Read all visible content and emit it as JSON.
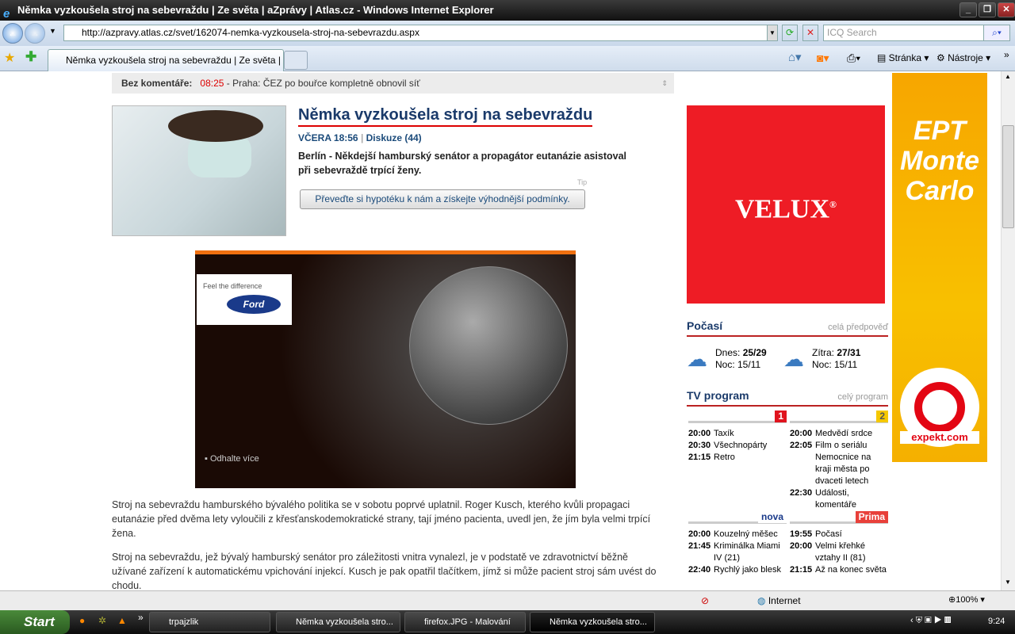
{
  "window": {
    "title": "Němka vyzkoušela stroj na sebevraždu | Ze světa | aZprávy | Atlas.cz - Windows Internet Explorer"
  },
  "browser": {
    "url": "http://azpravy.atlas.cz/svet/162074-nemka-vyzkousela-stroj-na-sebevrazdu.aspx",
    "search_placeholder": "ICQ Search",
    "tab_label": "Němka vyzkoušela stroj na sebevraždu | Ze světa | a...",
    "page_menu": "Stránka",
    "tools_menu": "Nástroje"
  },
  "ticker": {
    "label": "Bez komentáře:",
    "time": "08:25",
    "text": "- Praha: ČEZ po bouřce kompletně obnovil síť"
  },
  "article": {
    "title": "Němka vyzkoušela stroj na sebevraždu",
    "date": "VČERA 18:56",
    "discussion": "Diskuze (44)",
    "perex": "Berlín - Někdejší hamburský senátor a propagátor eutanázie asistoval při sebevraždě trpící ženy.",
    "tip_label": "Tip",
    "tip_button": "Převeďte si hypotéku k nám a získejte výhodnější podmínky.",
    "paragraphs": [
      "Stroj na sebevraždu hamburského bývalého politika se v sobotu poprvé uplatnil. Roger Kusch, kterého kvůli propagaci eutanázie před dvěma lety vyloučili z křesťanskodemokratické strany, tají jméno pacienta, uvedl jen, že jím byla velmi trpící žena.",
      "Stroj na sebevraždu, jež bývalý hamburský senátor pro záležitosti vnitra vynalezl, je v podstatě ve zdravotnictví běžně užívané zařízení k automatickému vpichování injekcí. Kusch je pak opatřil tlačítkem, jímž si může pacient stroj sám uvést do chodu."
    ]
  },
  "ford_ad": {
    "slogan": "Feel the difference",
    "brand": "Ford",
    "cta": "Odhalte více"
  },
  "velux_ad": {
    "brand": "VELUX",
    "mark": "®"
  },
  "weather": {
    "title": "Počasí",
    "link": "celá předpověď",
    "today_label": "Dnes:",
    "today": "25/29",
    "today_night": "Noc: 15/11",
    "tomorrow_label": "Zítra:",
    "tomorrow": "27/31",
    "tomorrow_night": "Noc: 15/11"
  },
  "tv": {
    "title": "TV program",
    "link": "celý program",
    "channels": [
      {
        "logo": "1",
        "color": "#e0141e",
        "shows": [
          [
            "20:00",
            "Taxík"
          ],
          [
            "20:30",
            "Všechnopárty"
          ],
          [
            "21:15",
            "Retro"
          ]
        ]
      },
      {
        "logo": "2",
        "color": "#f5c800",
        "shows": [
          [
            "20:00",
            "Medvědí srdce"
          ],
          [
            "22:05",
            "Film o seriálu Nemocnice na kraji města po dvaceti letech"
          ],
          [
            "22:30",
            "Události, komentáře"
          ]
        ]
      },
      {
        "logo": "nova",
        "color": "#1a3a8a",
        "shows": [
          [
            "20:00",
            "Kouzelný měšec"
          ],
          [
            "21:45",
            "Kriminálka Miami IV (21)"
          ],
          [
            "22:40",
            "Rychlý jako blesk"
          ]
        ]
      },
      {
        "logo": "Prima",
        "color": "#e8403a",
        "shows": [
          [
            "19:55",
            "Počasí"
          ],
          [
            "20:00",
            "Velmi křehké vztahy II (81)"
          ],
          [
            "21:15",
            "Až na konec světa"
          ]
        ]
      }
    ]
  },
  "sky_ad": {
    "text1": "EPT",
    "text2": "Monte",
    "text3": "Carlo",
    "brand": "expekt.com"
  },
  "status": {
    "zone": "Internet",
    "zoom": "100%"
  },
  "taskbar": {
    "start": "Start",
    "tasks": [
      "trpajzlik",
      "Němka vyzkoušela stro...",
      "firefox.JPG - Malování",
      "Němka vyzkoušela stro..."
    ],
    "clock": "9:24"
  }
}
